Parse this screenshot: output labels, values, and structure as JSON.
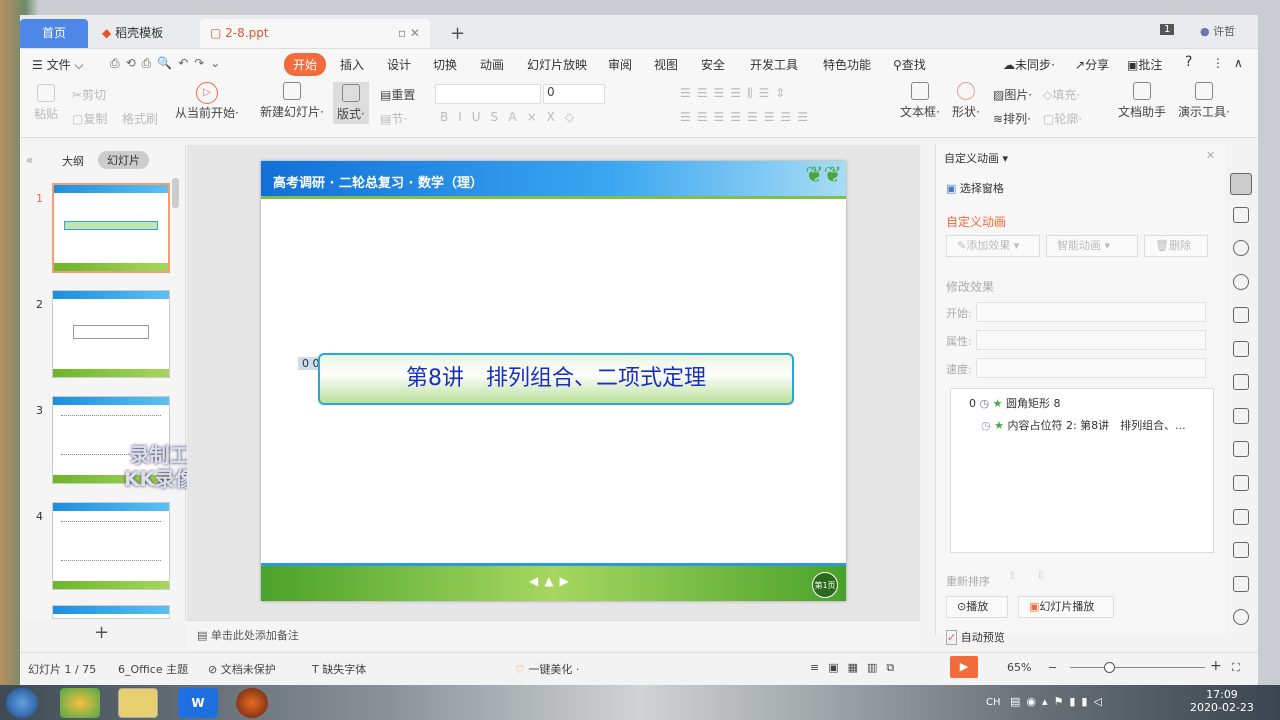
{
  "tabs": [
    {
      "label": "首页"
    },
    {
      "label": "稻壳模板"
    },
    {
      "label": "2-8.ppt"
    }
  ],
  "user": {
    "name": "许哲",
    "badge": "1"
  },
  "menu": {
    "file": "文件",
    "items": [
      "开始",
      "插入",
      "设计",
      "切换",
      "动画",
      "幻灯片放映",
      "审阅",
      "视图",
      "安全",
      "开发工具",
      "特色功能"
    ],
    "active": "开始",
    "search": "查找",
    "sync": "未同步",
    "share": "分享",
    "comment": "批注",
    "help": "?"
  },
  "ribbon": {
    "paste": "粘贴",
    "cut": "剪切",
    "copy": "复制",
    "format_painter": "格式刷",
    "from_current": "从当前开始",
    "new_slide": "新建幻灯片",
    "layout": "版式",
    "reset": "重置",
    "section": "节",
    "font_size": "0",
    "textbox": "文本框",
    "shape": "形状",
    "picture": "图片",
    "fill": "填充",
    "arrange": "排列",
    "outline": "轮廓",
    "doc_helper": "文档助手",
    "present_tools": "演示工具"
  },
  "left": {
    "tab_outline": "大纲",
    "tab_slides": "幻灯片",
    "slides": [
      "1",
      "2",
      "3",
      "4"
    ],
    "add": "+"
  },
  "slide": {
    "header": "高考调研 · 二轮总复习 · 数学（理）",
    "anim_tag": "0 0",
    "title": "第8讲　排列组合、二项式定理",
    "page_badge": "第1页"
  },
  "notes": {
    "placeholder": "单击此处添加备注"
  },
  "watermark": {
    "line1": "录制工具",
    "line2": "KK录像机"
  },
  "pane": {
    "title": "自定义动画",
    "select_pane": "选择窗格",
    "section": "自定义动画",
    "add_effect": "添加效果",
    "smart_anim": "智能动画",
    "delete": "删除",
    "modify": "修改效果",
    "start": "开始:",
    "property": "属性:",
    "speed": "速度:",
    "items": [
      {
        "num": "0",
        "label": "圆角矩形 8"
      },
      {
        "num": "",
        "label": "内容占位符 2: 第8讲　排列组合、..."
      }
    ],
    "reorder": "重新排序",
    "play": "播放",
    "slideshow": "幻灯片播放",
    "autopreview": "自动预览"
  },
  "status": {
    "slide": "幻灯片 1 / 75",
    "theme": "6_Office 主题",
    "protect": "文档未保护",
    "font": "缺失字体",
    "beautify": "一键美化",
    "zoom": "65%"
  },
  "taskbar": {
    "time": "17:09",
    "date": "2020-02-23",
    "lang": "CH"
  },
  "colors": {
    "accent": "#f26b3a",
    "slide_blue": "#1b8fe0",
    "slide_green": "#6db52a",
    "title_text": "#1a2fc0"
  }
}
